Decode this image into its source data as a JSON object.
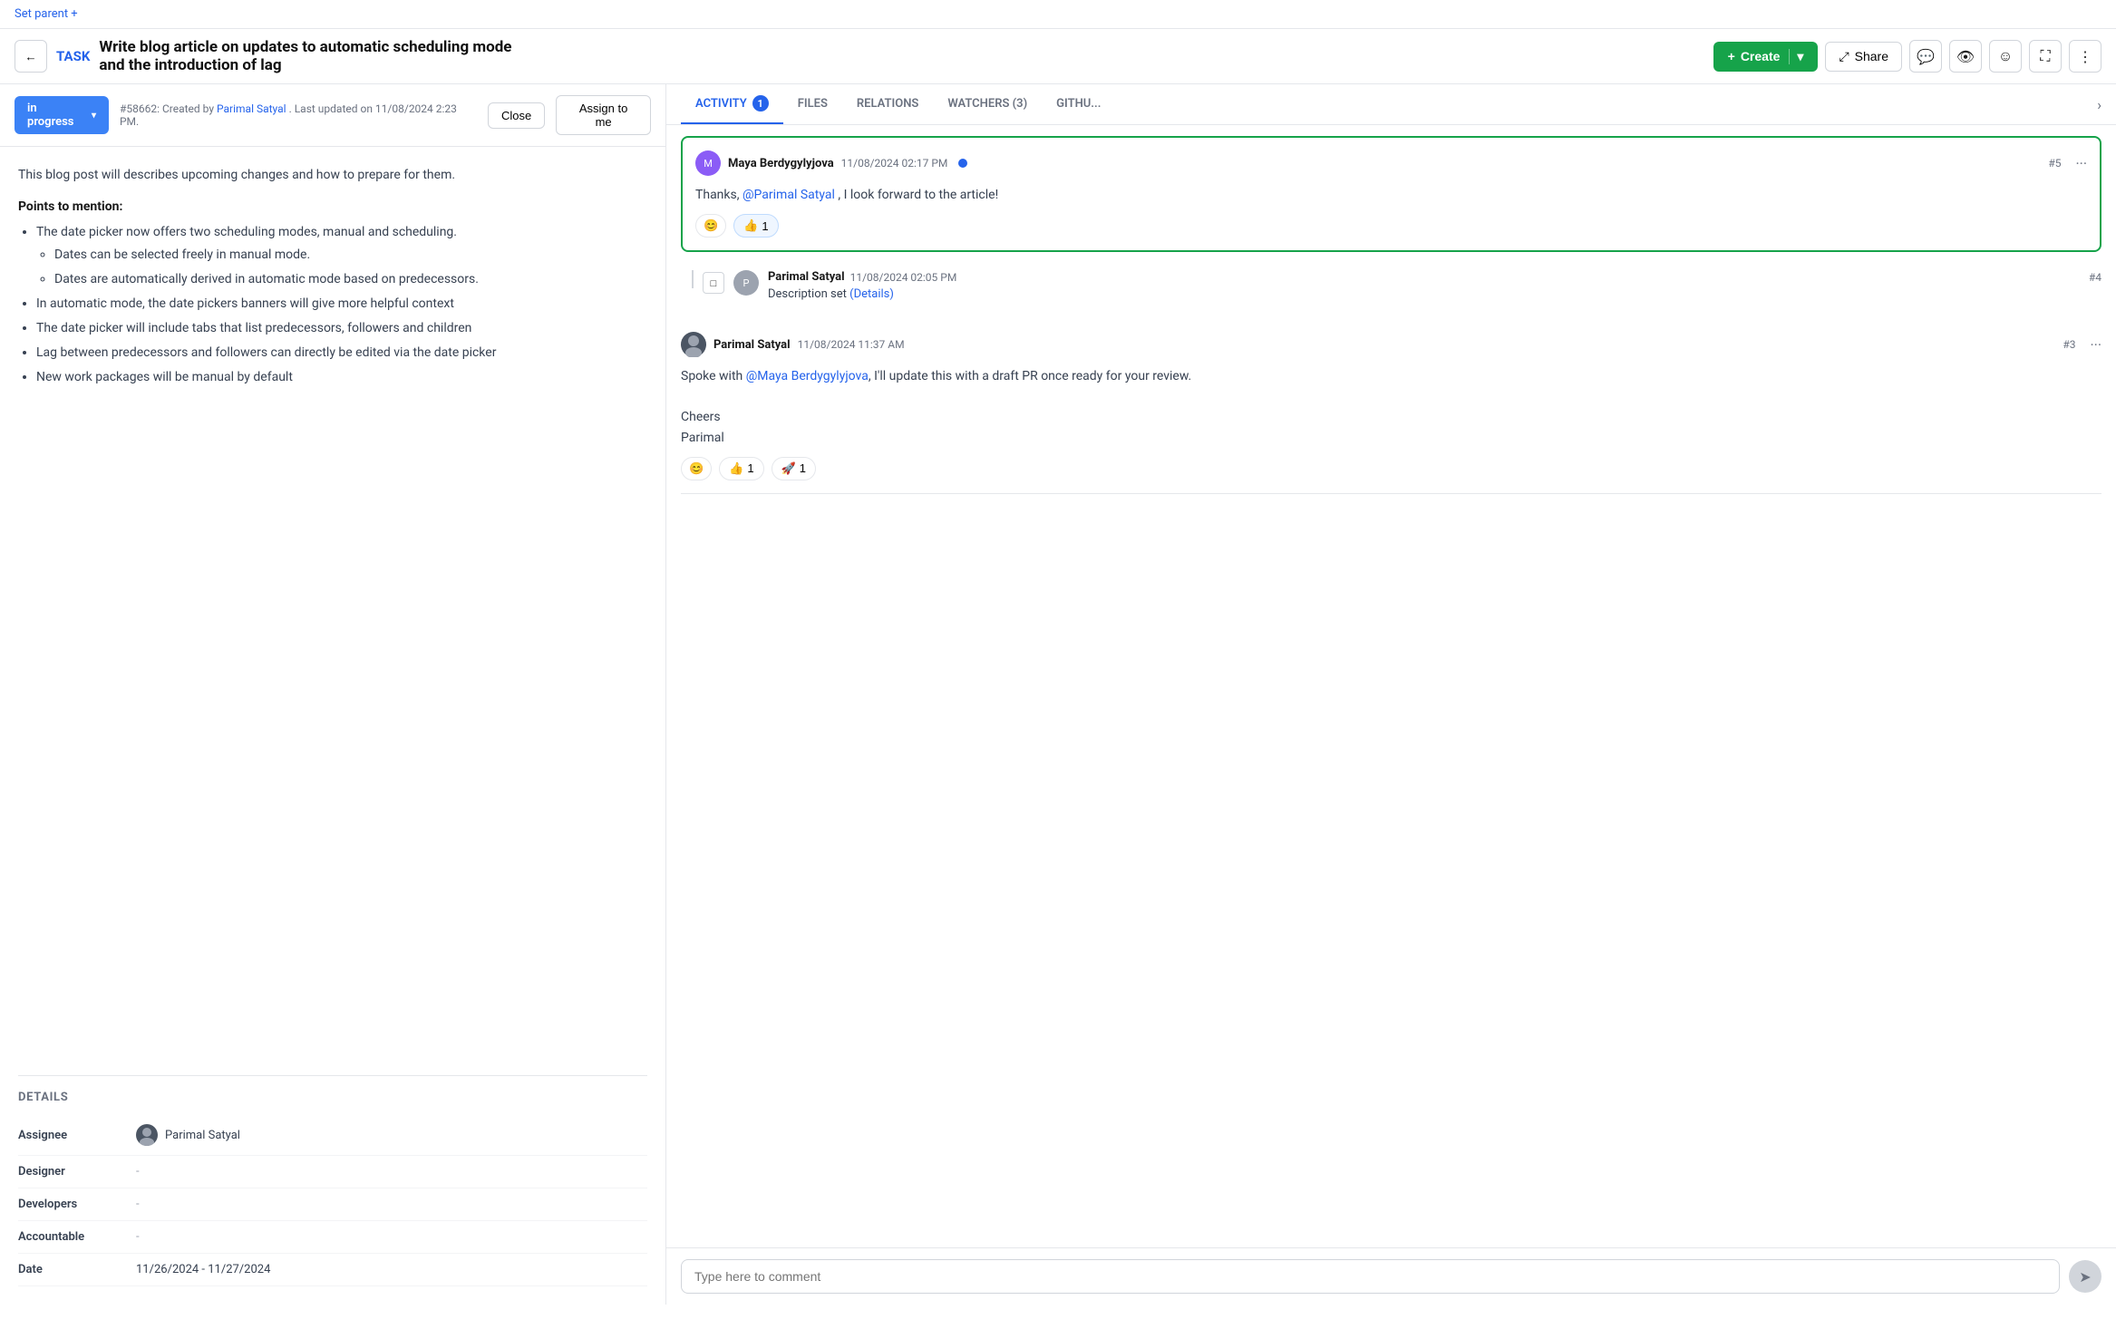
{
  "topbar": {
    "set_parent": "Set parent +"
  },
  "header": {
    "task_badge": "TASK",
    "title_line1": "Write blog article on updates to automatic scheduling mode",
    "title_line2": "and the introduction of lag",
    "create_label": "Create",
    "share_label": "Share"
  },
  "status_bar": {
    "status": "in progress",
    "meta": "#58662: Created by",
    "author": "Parimal Satyal",
    "last_updated": ". Last updated on 11/08/2024 2:23 PM.",
    "close_label": "Close",
    "assign_label": "Assign to me"
  },
  "description": {
    "intro": "This blog post will describes upcoming changes and how to prepare for them.",
    "points_title": "Points to mention:",
    "bullets": [
      "The date picker now offers two scheduling modes, manual and scheduling.",
      "In automatic mode, the date pickers banners will give more helpful context",
      "The date picker will include tabs that list predecessors, followers and children",
      "Lag between predecessors and followers can directly be edited via the date picker",
      "New work packages will be manual by default"
    ],
    "sub_bullets": [
      "Dates can be selected freely in manual mode.",
      "Dates are automatically derived in automatic mode based on predecessors."
    ]
  },
  "details": {
    "section_title": "DETAILS",
    "rows": [
      {
        "label": "Assignee",
        "value": "Parimal Satyal",
        "has_avatar": true
      },
      {
        "label": "Designer",
        "value": "-",
        "has_avatar": false
      },
      {
        "label": "Developers",
        "value": "-",
        "has_avatar": false
      },
      {
        "label": "Accountable",
        "value": "-",
        "has_avatar": false
      },
      {
        "label": "Date",
        "value": "11/26/2024 - 11/27/2024",
        "has_avatar": false
      }
    ]
  },
  "tabs": [
    {
      "label": "ACTIVITY",
      "badge": "1",
      "active": true
    },
    {
      "label": "FILES",
      "badge": "",
      "active": false
    },
    {
      "label": "RELATIONS",
      "badge": "",
      "active": false
    },
    {
      "label": "WATCHERS (3)",
      "badge": "",
      "active": false
    },
    {
      "label": "GITHU...",
      "badge": "",
      "active": false
    }
  ],
  "activity": {
    "comments": [
      {
        "id": "c1",
        "author": "Maya Berdygylyjova",
        "time": "11/08/2024 02:17 PM",
        "number": "#5",
        "body": "Thanks, @Parimal Satyal , I look forward to the article!",
        "mention": "@Parimal Satyal",
        "reactions": [
          {
            "emoji": "👍",
            "count": "1",
            "active": true
          }
        ],
        "highlighted": true
      },
      {
        "id": "c3",
        "author": "Parimal Satyal",
        "time": "11/08/2024 11:37 AM",
        "number": "#3",
        "body_parts": [
          "Spoke with ",
          "@Maya Berdygylyjova",
          ", I'll update this with a draft PR once ready for your review.",
          "\n\nCheers\nParimal"
        ],
        "reactions": [
          {
            "emoji": "👍",
            "count": "1",
            "active": false
          },
          {
            "emoji": "🚀",
            "count": "1",
            "active": false
          }
        ],
        "highlighted": false
      }
    ],
    "activity_item": {
      "author": "Parimal Satyal",
      "time": "11/08/2024 02:05 PM",
      "number": "#4",
      "text": "Description set",
      "link": "(Details)"
    }
  },
  "comment_input": {
    "placeholder": "Type here to comment"
  },
  "icons": {
    "back": "←",
    "chevron_down": "▾",
    "plus": "+",
    "share": "⤢",
    "comment_icon": "💬",
    "eye": "👁",
    "face": "☺",
    "fullscreen": "⛶",
    "more": "⋮",
    "send": "➤",
    "add_emoji": "😊"
  }
}
